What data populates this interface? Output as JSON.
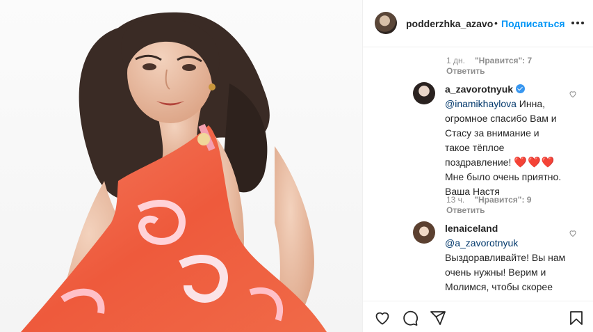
{
  "post": {
    "username": "podderzhka_azavoi",
    "follow_label": "Подписаться",
    "separator": "•"
  },
  "comments": [
    {
      "meta": {
        "time": "1 дн.",
        "likes": "\"Нравится\": 7",
        "reply": "Ответить"
      }
    },
    {
      "author": "a_zavorotnyuk",
      "verified": true,
      "mention": "@inamikhaylova",
      "text_a": " Инна, огромное спасибо Вам и Стасу за внимание и такое тёплое поздравление! ",
      "emoji": "❤️❤️❤️",
      "text_b": " Мне было очень приятно. Ваша Настя",
      "meta": {
        "time": "13 ч.",
        "likes": "\"Нравится\": 9",
        "reply": "Ответить"
      }
    },
    {
      "author": "lenaiceland",
      "mention": "@a_zavorotnyuk",
      "text_a": " Выздоравливайте! Вы нам очень нужны! Верим и Молимся, чтобы скорее все"
    }
  ],
  "icons": {
    "like": "heart-icon",
    "comment": "comment-icon",
    "share": "share-icon",
    "save": "bookmark-icon",
    "more": "more-icon",
    "verified": "verified-badge-icon"
  },
  "colors": {
    "accent": "#0095f6",
    "verified": "#3897f0",
    "mention": "#00376b",
    "muted": "#8e8e8e",
    "heart_emoji": "#e0182d",
    "border": "#efefef"
  }
}
